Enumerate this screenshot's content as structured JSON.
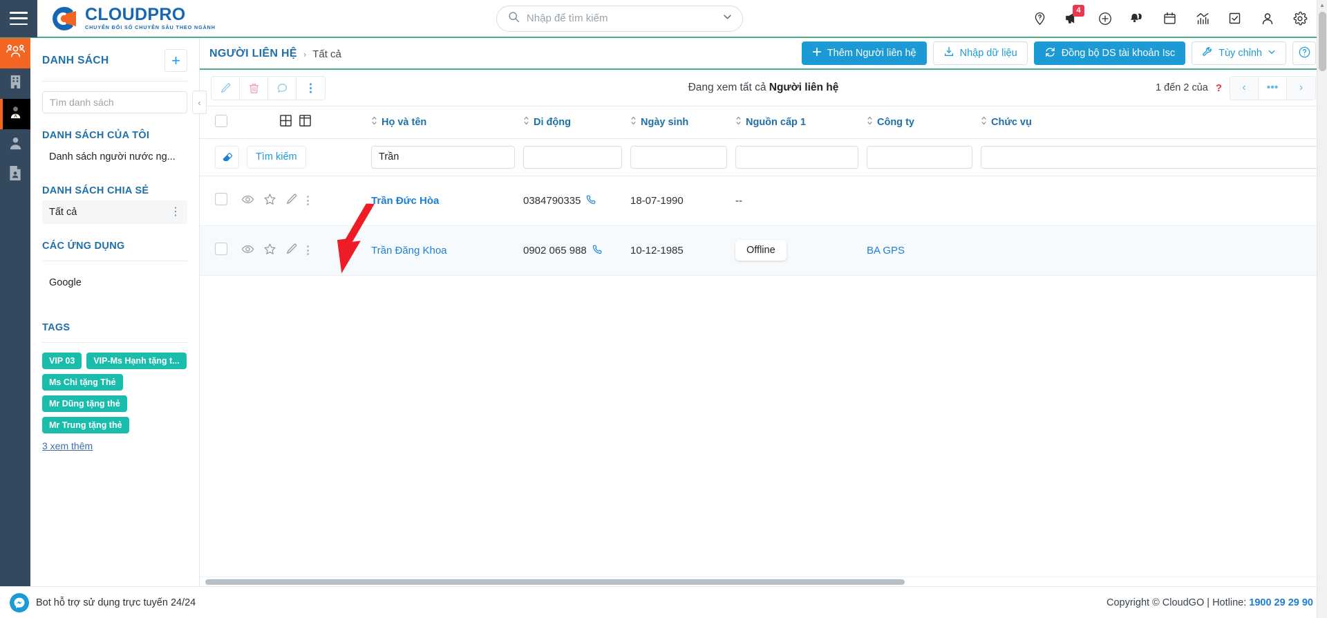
{
  "brand": {
    "name": "CLOUDPRO",
    "tagline": "CHUYỂN ĐỔI SỐ CHUYÊN SÂU THEO NGÀNH",
    "accent": "#1666b4",
    "orange": "#f26522"
  },
  "topbar": {
    "menu_icon": "hamburger-icon",
    "search_placeholder": "Nhập để tìm kiếm",
    "search_value": "",
    "icons": [
      {
        "name": "help-pin-icon",
        "badge": ""
      },
      {
        "name": "megaphone-icon",
        "badge": "4"
      },
      {
        "name": "plus-circle-icon",
        "badge": ""
      },
      {
        "name": "bells-icon",
        "badge": ""
      },
      {
        "name": "calendar-icon",
        "badge": ""
      },
      {
        "name": "analytics-icon",
        "badge": ""
      },
      {
        "name": "task-check-icon",
        "badge": ""
      },
      {
        "name": "user-icon",
        "badge": ""
      },
      {
        "name": "gear-icon",
        "badge": ""
      }
    ]
  },
  "rail": {
    "items": [
      {
        "name": "contacts-icon",
        "state": "active-orange"
      },
      {
        "name": "company-icon",
        "state": ""
      },
      {
        "name": "lead-icon",
        "state": "active-dark"
      },
      {
        "name": "person-icon",
        "state": ""
      },
      {
        "name": "document-person-icon",
        "state": ""
      }
    ]
  },
  "breadcrumb": {
    "main": "NGƯỜI LIÊN HỆ",
    "separator": "›",
    "sub": "Tất cả"
  },
  "actions": {
    "add_contact": "Thêm Người liên hệ",
    "import_data": "Nhập dữ liệu",
    "sync_account": "Đồng bộ DS tài khoản Isc",
    "customize": "Tùy chỉnh",
    "help": "?"
  },
  "sidebar": {
    "title": "DANH SÁCH",
    "add_label": "+",
    "search_placeholder": "Tìm danh sách",
    "search_value": "",
    "sections": [
      {
        "heading": "DANH SÁCH CỦA TÔI",
        "items": [
          {
            "label": "Danh sách người nước ng...",
            "selected": false
          }
        ]
      },
      {
        "heading": "DANH SÁCH CHIA SẺ",
        "items": [
          {
            "label": "Tất cả",
            "selected": true
          }
        ]
      },
      {
        "heading": "CÁC ỨNG DỤNG",
        "items": [
          {
            "label": "Google",
            "selected": false
          }
        ]
      }
    ],
    "tags_heading": "TAGS",
    "tags": [
      "VIP 03",
      "VIP-Ms Hạnh tặng t...",
      "Ms Chi tặng Thẻ",
      "Mr Dũng tặng thẻ",
      "Mr Trung tặng thẻ"
    ],
    "tag_color": "#1abcac",
    "more_tags": "3  xem thêm"
  },
  "toolbar": {
    "buttons": [
      {
        "name": "edit-icon"
      },
      {
        "name": "delete-icon"
      },
      {
        "name": "comment-icon"
      },
      {
        "name": "more-vertical-icon"
      }
    ],
    "viewing_prefix": "Đang xem tất cả ",
    "viewing_entity": "Người liên hệ",
    "pager_text": "1 đến 2 của",
    "pager_unknown": "?",
    "pager_prev": "‹",
    "pager_mid": "•••",
    "pager_next": "›"
  },
  "table": {
    "view_icons": [
      {
        "name": "grid-view-icon"
      },
      {
        "name": "split-view-icon"
      }
    ],
    "columns": [
      "Họ và tên",
      "Di động",
      "Ngày sinh",
      "Nguồn cấp 1",
      "Công ty",
      "Chức vụ"
    ],
    "filter": {
      "erase_icon": "eraser-icon",
      "search_label": "Tìm kiếm",
      "values": [
        "Trần",
        "",
        "",
        "",
        "",
        ""
      ]
    },
    "rows": [
      {
        "name": "Trần Đức Hòa",
        "mobile": "0384790335",
        "birthday": "18-07-1990",
        "source": "--",
        "source_type": "text",
        "company": "",
        "position": ""
      },
      {
        "name": "Trần Đăng Khoa",
        "mobile": "0902 065 988",
        "birthday": "10-12-1985",
        "source": "Offline",
        "source_type": "badge",
        "company": "BA GPS",
        "position": ""
      }
    ]
  },
  "footer": {
    "bot_text": "Bot hỗ trợ sử dụng trực tuyến 24/24",
    "copyright": "Copyright © CloudGO | Hotline: ",
    "hotline": "1900 29 29 90"
  },
  "annotation": {
    "name": "red-arrow-pointer",
    "color": "#ee1c25"
  }
}
